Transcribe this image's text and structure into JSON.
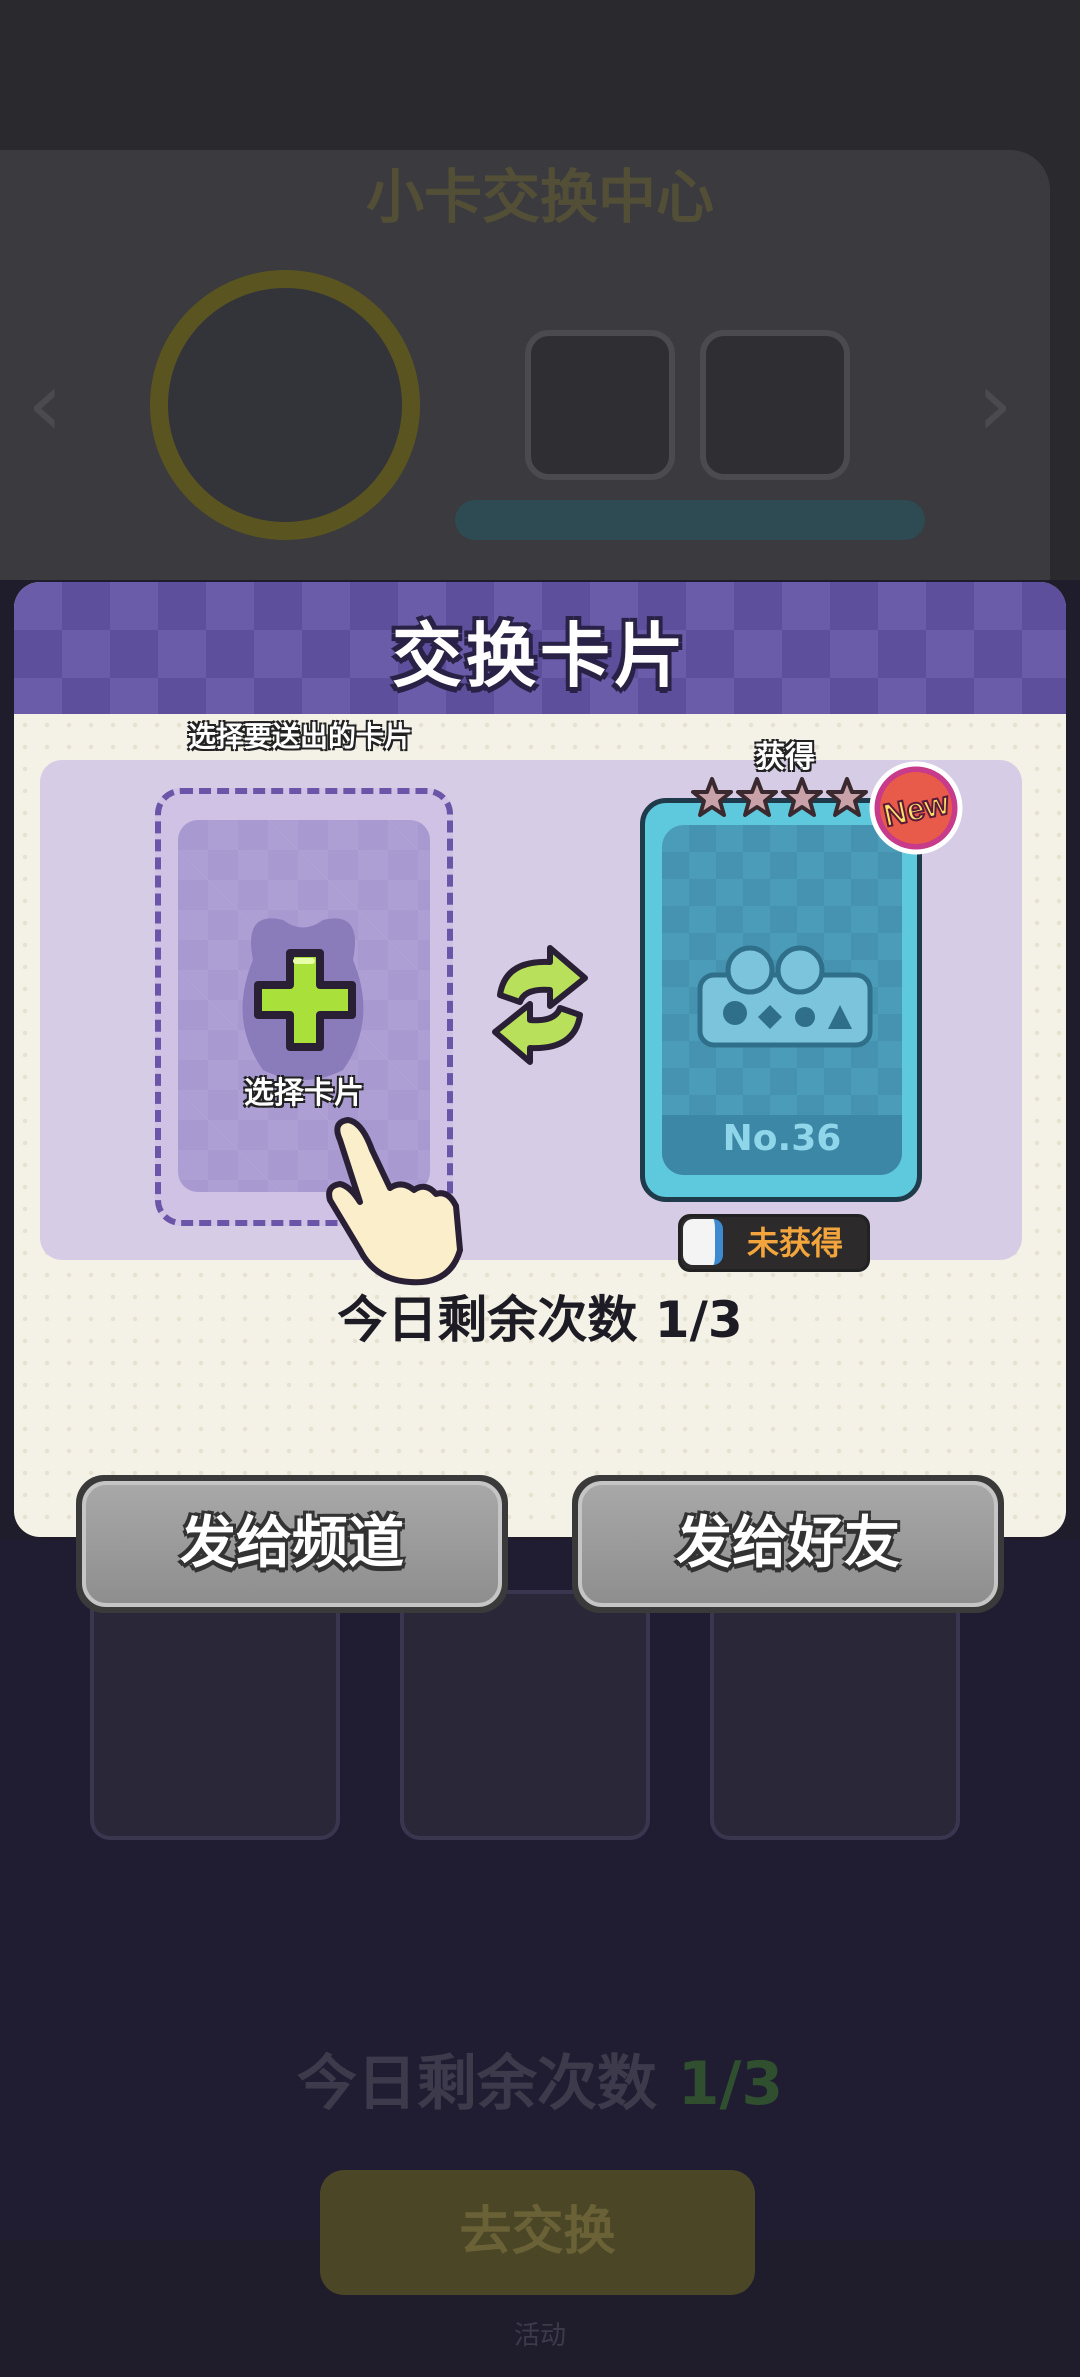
{
  "background": {
    "event_title": "小卡交换中心",
    "remaining_text": "今日剩余次数",
    "remaining_value": "1/3",
    "action_button": "去交换",
    "footer": "活动"
  },
  "dialog": {
    "title": "交换卡片",
    "give_caption": "选择要送出的卡片",
    "select_card_label": "选择卡片",
    "receive_caption": "获得",
    "card": {
      "number": "No.36",
      "stars": 4,
      "new_badge": "New",
      "status": "未获得"
    },
    "remaining": "今日剩余次数 1/3",
    "send_channel_button": "发给频道",
    "send_friend_button": "发给好友"
  },
  "colors": {
    "header": "#6a5ca8",
    "card": "#5ec8dc",
    "status_text": "#f2a53c",
    "plus": "#a9e03a"
  }
}
